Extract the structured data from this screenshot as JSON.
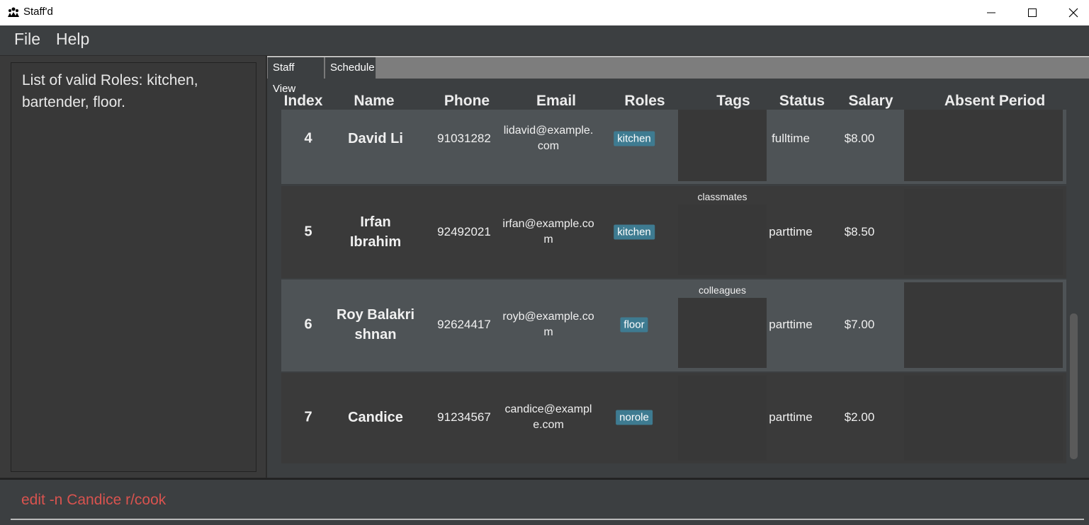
{
  "window": {
    "title": "Staff'd",
    "icon": "staff-icon"
  },
  "menu": {
    "file": "File",
    "help": "Help"
  },
  "result": {
    "text": "List of valid Roles: kitchen, bartender, floor."
  },
  "tabs": [
    {
      "label": "Staff View"
    },
    {
      "label": "Schedule"
    }
  ],
  "columns": {
    "index": "Index",
    "name": "Name",
    "phone": "Phone",
    "email": "Email",
    "roles": "Roles",
    "tags": "Tags",
    "status": "Status",
    "salary": "Salary",
    "absent": "Absent Period"
  },
  "rows": [
    {
      "index": "4",
      "name": "David Li",
      "phone": "91031282",
      "email": "lidavid@example.com",
      "role": "kitchen",
      "tag": "",
      "status": "fulltime",
      "salary": "$8.00"
    },
    {
      "index": "5",
      "name": "Irfan Ibrahim",
      "phone": "92492021",
      "email": "irfan@example.com",
      "role": "kitchen",
      "tag": "classmates",
      "status": "parttime",
      "salary": "$8.50"
    },
    {
      "index": "6",
      "name": "Roy Balakrishnan",
      "phone": "92624417",
      "email": "royb@example.com",
      "role": "floor",
      "tag": "colleagues",
      "status": "parttime",
      "salary": "$7.00"
    },
    {
      "index": "7",
      "name": "Candice",
      "phone": "91234567",
      "email": "candice@example.com",
      "role": "norole",
      "tag": "",
      "status": "parttime",
      "salary": "$2.00"
    }
  ],
  "command": {
    "value": "edit -n Candice r/cook"
  },
  "colors": {
    "role_badge": "#3e7b91",
    "command_text": "#d9534f",
    "selected_row": "#4e5356"
  }
}
